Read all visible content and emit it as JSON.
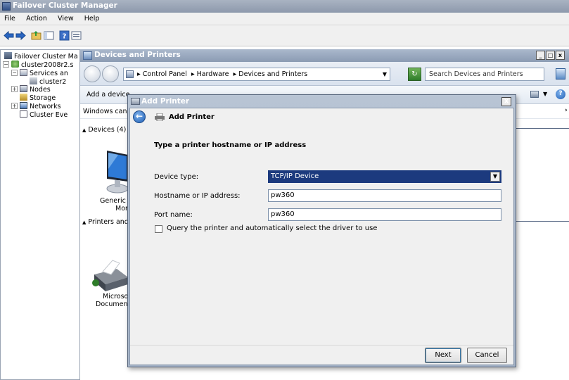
{
  "app": {
    "title": "Failover Cluster Manager",
    "menu": [
      "File",
      "Action",
      "View",
      "Help"
    ]
  },
  "tree": {
    "root": "Failover Cluster Ma",
    "cluster": "cluster2008r2.s",
    "services": "Services an",
    "service_child": "cluster2",
    "nodes": "Nodes",
    "storage": "Storage",
    "networks": "Networks",
    "events": "Cluster Eve"
  },
  "devices_window": {
    "title": "Devices and Printers",
    "breadcrumb": [
      "Control Panel",
      "Hardware",
      "Devices and Printers"
    ],
    "search_placeholder": "Search Devices and Printers",
    "add_device": "Add a device",
    "info_bar": "Windows can c",
    "devices_group": "Devices (4)",
    "device_label_1": "Generic Nc",
    "device_label_2": "Monit",
    "printers_group": "Printers and",
    "printer_label_1": "Microsof",
    "printer_label_2": "Document"
  },
  "dialog": {
    "title": "Add Printer",
    "heading": "Add Printer",
    "instruction": "Type a printer hostname or IP address",
    "device_type_label": "Device type:",
    "device_type_value": "TCP/IP Device",
    "hostname_label": "Hostname or IP address:",
    "hostname_value": "pw360",
    "port_label": "Port name:",
    "port_value": "pw360",
    "query_label": "Query the printer and automatically select the driver to use",
    "query_checked": false,
    "next_label": "Next",
    "cancel_label": "Cancel"
  },
  "colors": {
    "title_bar": "#8d99ac",
    "dialog_frame": "#a5b3c7",
    "selection": "#1c3a7e"
  },
  "icons": [
    "app-icon",
    "back-arrow-icon",
    "forward-arrow-icon",
    "folder-up-icon",
    "console-tree-icon",
    "help-icon",
    "properties-icon",
    "cluster-icon",
    "services-icon",
    "nodes-icon",
    "storage-icon",
    "networks-icon",
    "events-icon",
    "control-panel-icon",
    "refresh-icon",
    "search-icon",
    "view-icon",
    "printer-icon",
    "monitor-icon"
  ]
}
